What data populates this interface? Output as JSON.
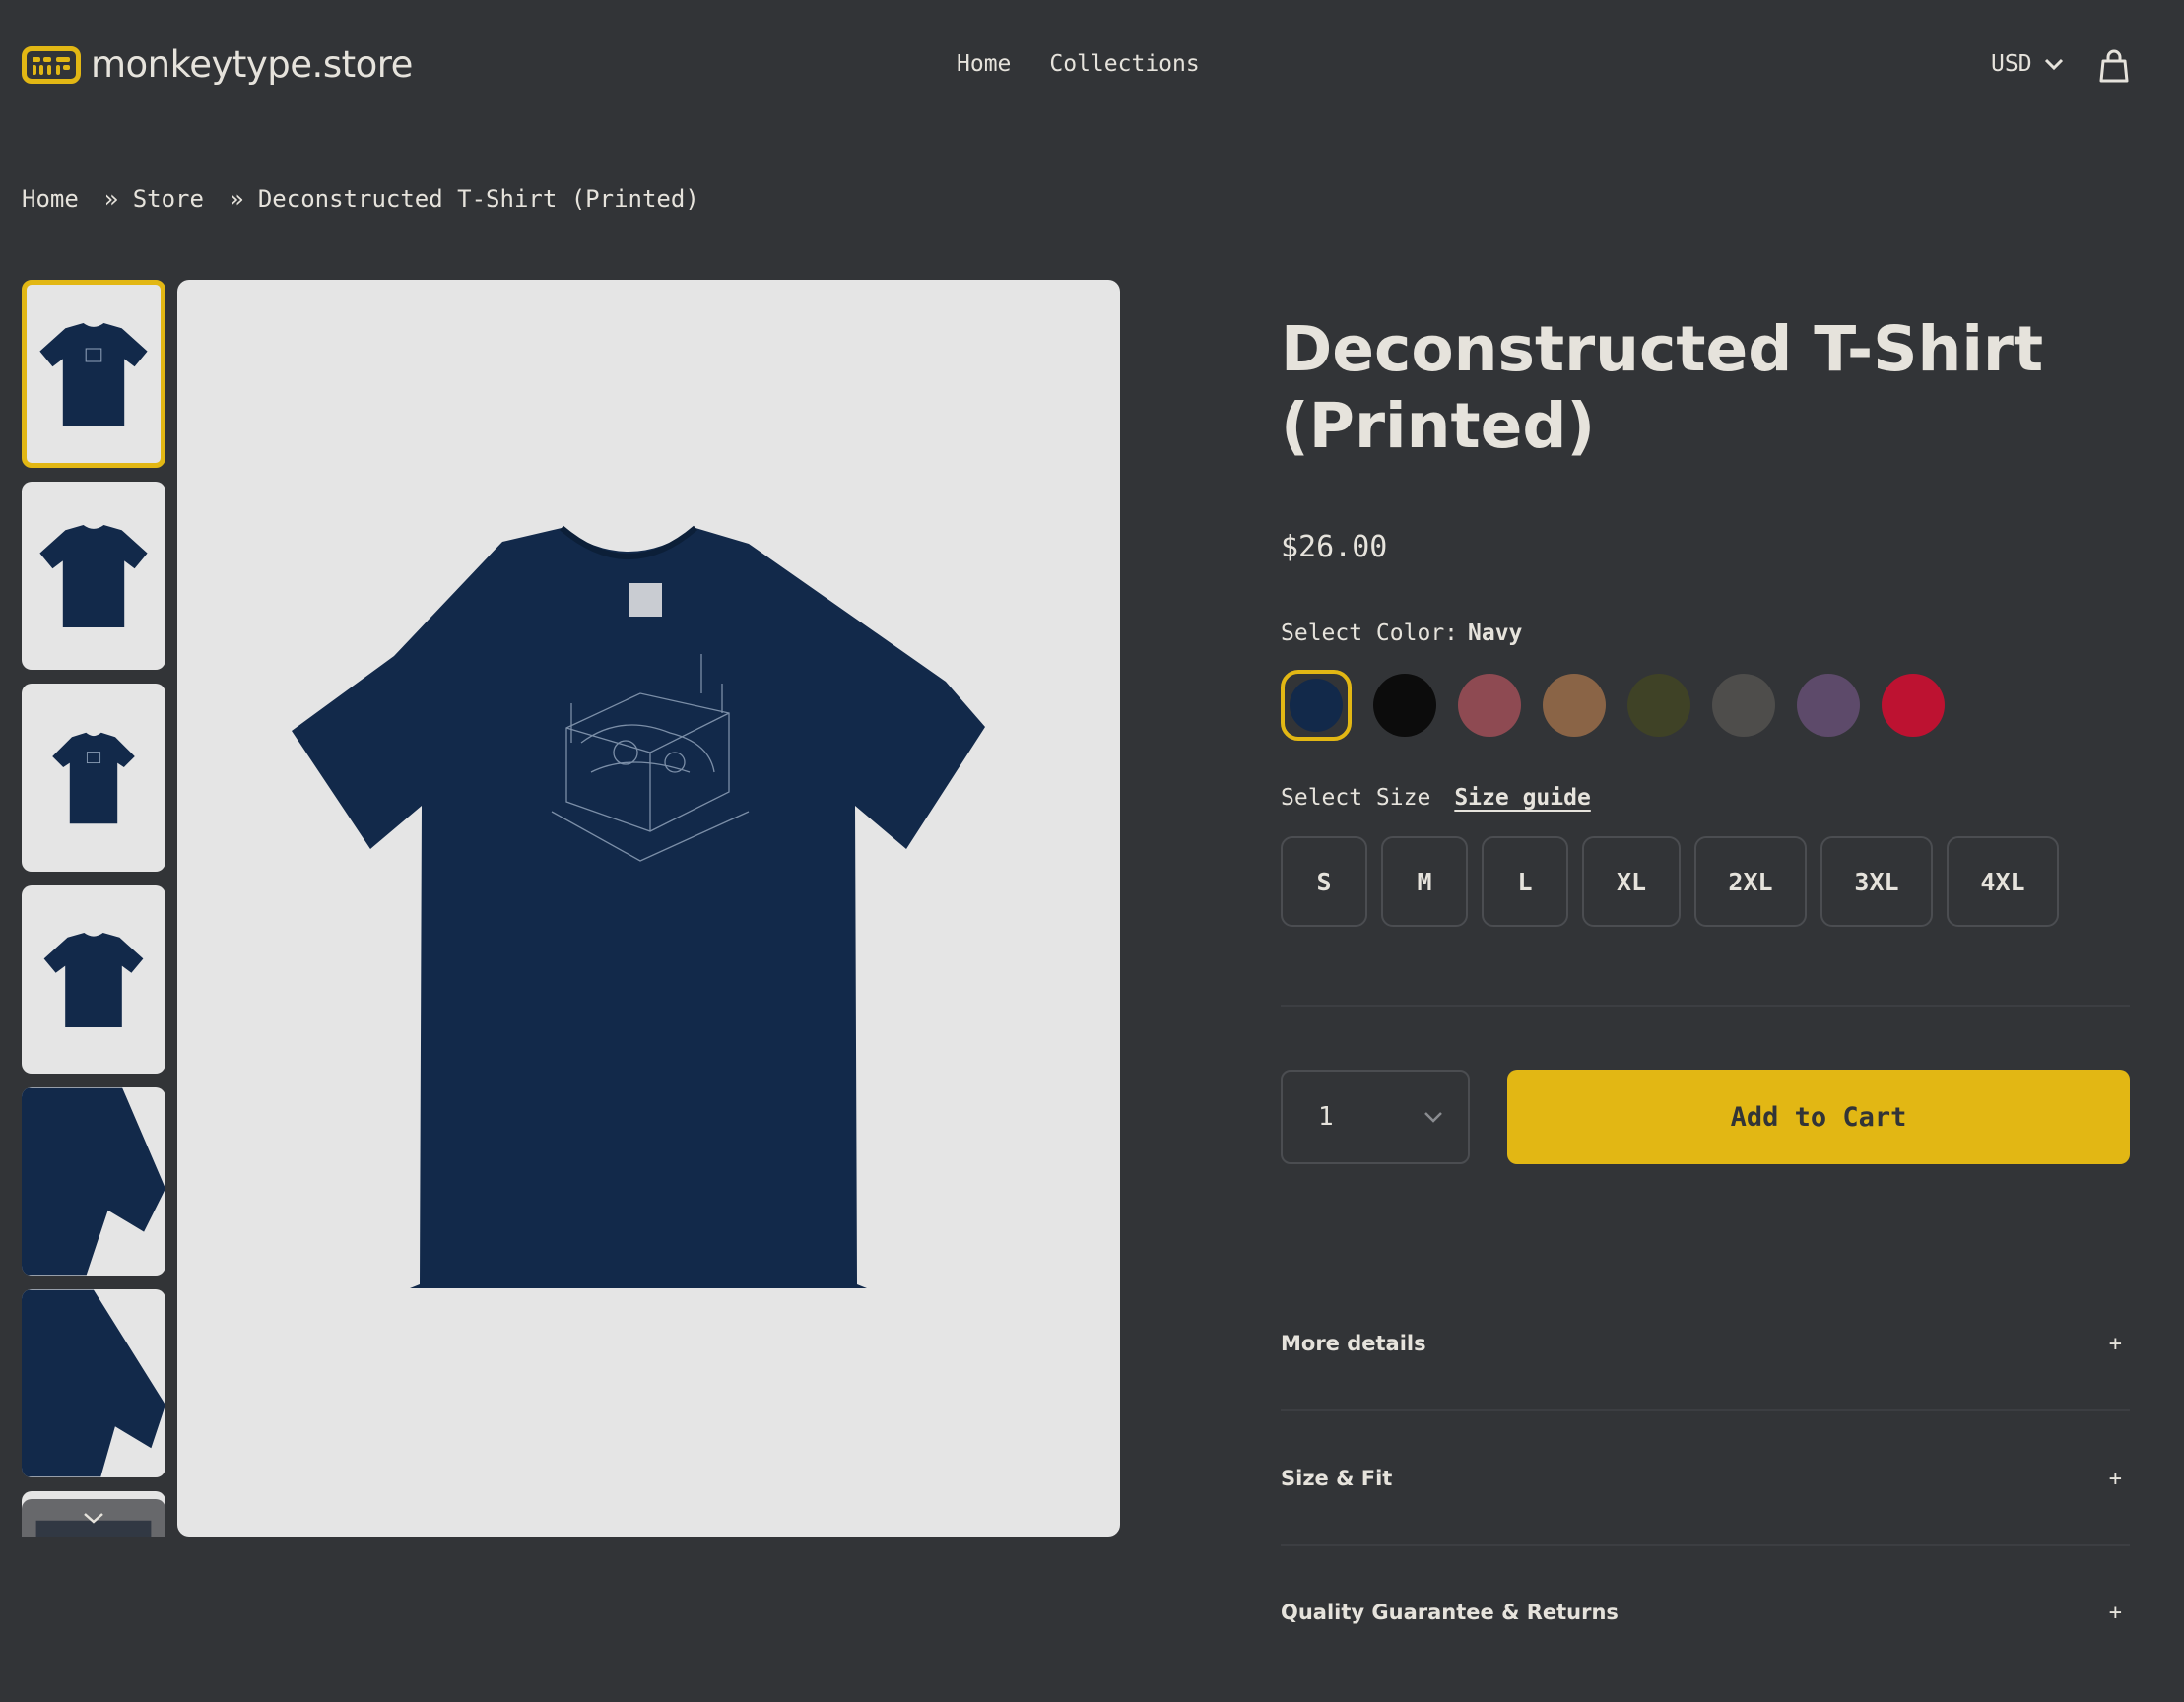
{
  "header": {
    "logo_text": "monkeytype.store",
    "nav": [
      "Home",
      "Collections"
    ],
    "currency": "USD"
  },
  "breadcrumb": [
    "Home",
    "»  Store",
    "»  Deconstructed T-Shirt (Printed)"
  ],
  "product": {
    "title": "Deconstructed T-Shirt (Printed)",
    "price": "$26.00",
    "color_label": "Select Color:",
    "selected_color": "Navy",
    "colors": [
      "#12294a",
      "#0c0c0c",
      "#8e4a52",
      "#8a6446",
      "#3f4226",
      "#4e4d4b",
      "#5d4a6a",
      "#bd1231"
    ],
    "size_label": "Select Size",
    "size_guide": "Size guide",
    "sizes": [
      "S",
      "M",
      "L",
      "XL",
      "2XL",
      "3XL",
      "4XL"
    ],
    "quantity": "1",
    "add_to_cart": "Add to Cart"
  },
  "accordion": [
    "More details",
    "Size & Fit",
    "Quality Guarantee & Returns"
  ],
  "accent_color": "#e2b714"
}
